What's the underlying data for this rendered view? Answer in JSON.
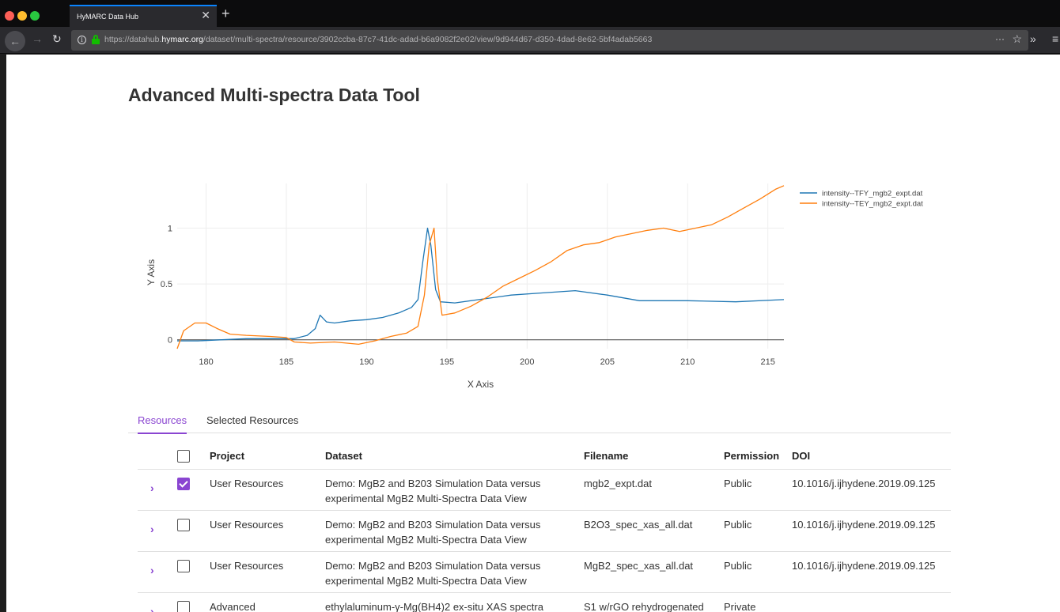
{
  "browser": {
    "tab_title": "HyMARC Data Hub",
    "tab_close": "✕",
    "new_tab": "+",
    "url_prefix": "https://datahub.",
    "url_host": "hymarc.org",
    "url_path": "/dataset/multi-spectra/resource/3902ccba-87c7-41dc-adad-b6a9082f2e02/view/9d944d67-d350-4dad-8e62-5bf4adab5663",
    "icons": [
      "back-arrow-icon",
      "forward-arrow-icon",
      "reload-icon",
      "info-icon",
      "lock-icon",
      "more-icon",
      "star-icon",
      "overflow-icon",
      "menu-icon"
    ]
  },
  "page": {
    "title": "Advanced Multi-spectra Data Tool"
  },
  "chart_data": {
    "type": "line",
    "xlabel": "X Axis",
    "ylabel": "Y Axis",
    "xlim": [
      178.2,
      216
    ],
    "ylim": [
      -0.08,
      1.4
    ],
    "xticks": [
      180,
      185,
      190,
      195,
      200,
      205,
      210,
      215
    ],
    "yticks": [
      0,
      0.5,
      1
    ],
    "ytick_labels": [
      "0",
      "0.5",
      "1"
    ],
    "grid": true,
    "legend_position": "top-right",
    "series": [
      {
        "name": "intensity--TFY_mgb2_expt.dat",
        "color": "#1f77b4",
        "points": [
          [
            178.2,
            -0.01
          ],
          [
            179.5,
            -0.01
          ],
          [
            181,
            0.0
          ],
          [
            182.5,
            0.01
          ],
          [
            184,
            0.01
          ],
          [
            185.5,
            0.01
          ],
          [
            186.3,
            0.04
          ],
          [
            186.8,
            0.1
          ],
          [
            187.1,
            0.22
          ],
          [
            187.5,
            0.16
          ],
          [
            188,
            0.15
          ],
          [
            189,
            0.17
          ],
          [
            190,
            0.18
          ],
          [
            191,
            0.2
          ],
          [
            192,
            0.24
          ],
          [
            192.8,
            0.29
          ],
          [
            193.2,
            0.36
          ],
          [
            193.5,
            0.7
          ],
          [
            193.8,
            1.0
          ],
          [
            194,
            0.85
          ],
          [
            194.3,
            0.45
          ],
          [
            194.6,
            0.34
          ],
          [
            195.5,
            0.33
          ],
          [
            197,
            0.36
          ],
          [
            199,
            0.4
          ],
          [
            201,
            0.42
          ],
          [
            203,
            0.44
          ],
          [
            205,
            0.4
          ],
          [
            207,
            0.35
          ],
          [
            210,
            0.35
          ],
          [
            213,
            0.34
          ],
          [
            216,
            0.36
          ]
        ]
      },
      {
        "name": "intensity--TEY_mgb2_expt.dat",
        "color": "#ff7f0e",
        "points": [
          [
            178.2,
            -0.08
          ],
          [
            178.6,
            0.08
          ],
          [
            179.3,
            0.15
          ],
          [
            180,
            0.15
          ],
          [
            180.7,
            0.1
          ],
          [
            181.5,
            0.05
          ],
          [
            182.5,
            0.04
          ],
          [
            184,
            0.03
          ],
          [
            185,
            0.02
          ],
          [
            185.5,
            -0.02
          ],
          [
            186.5,
            -0.03
          ],
          [
            188,
            -0.02
          ],
          [
            189.5,
            -0.04
          ],
          [
            190.5,
            -0.01
          ],
          [
            191.5,
            0.03
          ],
          [
            192.5,
            0.06
          ],
          [
            193.2,
            0.12
          ],
          [
            193.6,
            0.4
          ],
          [
            193.9,
            0.85
          ],
          [
            194.2,
            1.0
          ],
          [
            194.4,
            0.55
          ],
          [
            194.7,
            0.22
          ],
          [
            195.5,
            0.24
          ],
          [
            196.5,
            0.3
          ],
          [
            197.5,
            0.38
          ],
          [
            198.5,
            0.48
          ],
          [
            199.5,
            0.55
          ],
          [
            200.5,
            0.62
          ],
          [
            201.5,
            0.7
          ],
          [
            202.5,
            0.8
          ],
          [
            203.5,
            0.85
          ],
          [
            204.5,
            0.87
          ],
          [
            205.5,
            0.92
          ],
          [
            206.5,
            0.95
          ],
          [
            207.5,
            0.98
          ],
          [
            208.5,
            1.0
          ],
          [
            209.5,
            0.97
          ],
          [
            210.5,
            1.0
          ],
          [
            211.5,
            1.03
          ],
          [
            212.5,
            1.1
          ],
          [
            213.5,
            1.18
          ],
          [
            214.5,
            1.26
          ],
          [
            215.5,
            1.35
          ],
          [
            216,
            1.38
          ]
        ]
      }
    ]
  },
  "tabs": [
    {
      "label": "Resources",
      "active": true
    },
    {
      "label": "Selected Resources",
      "active": false
    }
  ],
  "table": {
    "headers": {
      "project": "Project",
      "dataset": "Dataset",
      "filename": "Filename",
      "permission": "Permission",
      "doi": "DOI"
    },
    "rows": [
      {
        "project": "User Resources",
        "dataset": "Demo: MgB2 and B203 Simulation Data versus experimental MgB2 Multi-Spectra Data View",
        "filename": "mgb2_expt.dat",
        "permission": "Public",
        "doi": "10.1016/j.ijhydene.2019.09.125",
        "checked": true
      },
      {
        "project": "User Resources",
        "dataset": "Demo: MgB2 and B203 Simulation Data versus experimental MgB2 Multi-Spectra Data View",
        "filename": "B2O3_spec_xas_all.dat",
        "permission": "Public",
        "doi": "10.1016/j.ijhydene.2019.09.125",
        "checked": false
      },
      {
        "project": "User Resources",
        "dataset": "Demo: MgB2 and B203 Simulation Data versus experimental MgB2 Multi-Spectra Data View",
        "filename": "MgB2_spec_xas_all.dat",
        "permission": "Public",
        "doi": "10.1016/j.ijhydene.2019.09.125",
        "checked": false
      },
      {
        "project": "Advanced",
        "dataset": "ethylaluminum-γ-Mg(BH4)2 ex-situ XAS spectra",
        "filename": "S1 w/rGO rehydrogenated",
        "permission": "Private",
        "doi": "",
        "checked": false
      }
    ],
    "chevron": "›"
  }
}
